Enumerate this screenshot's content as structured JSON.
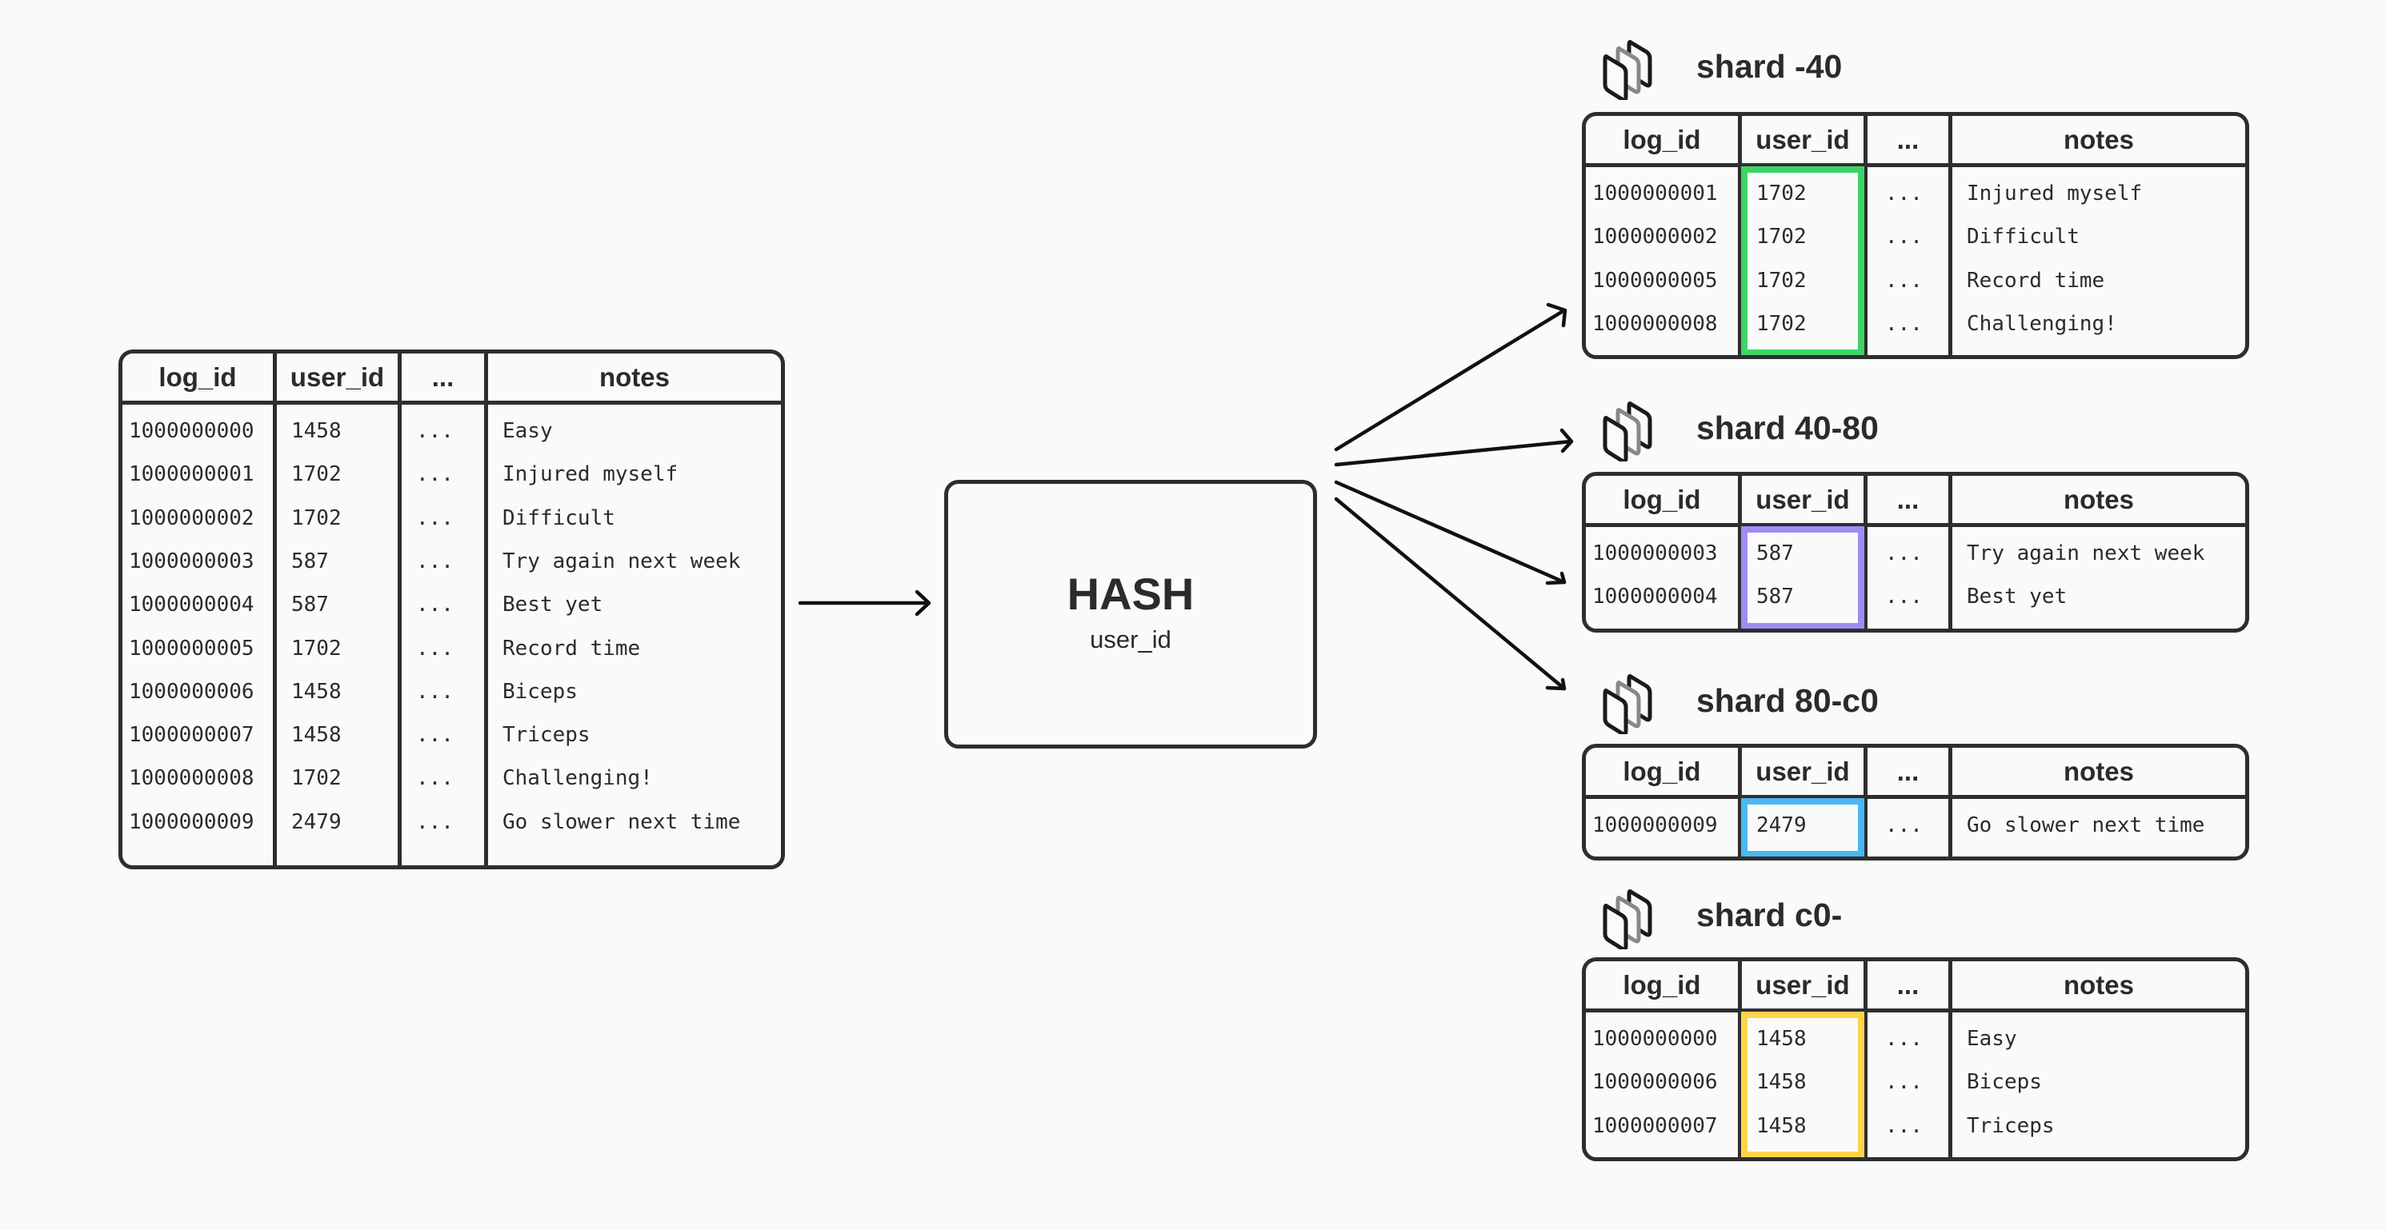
{
  "columns": [
    "log_id",
    "user_id",
    "...",
    "notes"
  ],
  "source_table": {
    "rows": [
      {
        "log_id": "1000000000",
        "user_id": "1458",
        "etc": "...",
        "notes": "Easy"
      },
      {
        "log_id": "1000000001",
        "user_id": "1702",
        "etc": "...",
        "notes": "Injured myself"
      },
      {
        "log_id": "1000000002",
        "user_id": "1702",
        "etc": "...",
        "notes": "Difficult"
      },
      {
        "log_id": "1000000003",
        "user_id": "587",
        "etc": "...",
        "notes": "Try again next week"
      },
      {
        "log_id": "1000000004",
        "user_id": "587",
        "etc": "...",
        "notes": "Best yet"
      },
      {
        "log_id": "1000000005",
        "user_id": "1702",
        "etc": "...",
        "notes": "Record time"
      },
      {
        "log_id": "1000000006",
        "user_id": "1458",
        "etc": "...",
        "notes": "Biceps"
      },
      {
        "log_id": "1000000007",
        "user_id": "1458",
        "etc": "...",
        "notes": "Triceps"
      },
      {
        "log_id": "1000000008",
        "user_id": "1702",
        "etc": "...",
        "notes": "Challenging!"
      },
      {
        "log_id": "1000000009",
        "user_id": "2479",
        "etc": "...",
        "notes": "Go slower next time"
      }
    ]
  },
  "hash": {
    "title": "HASH",
    "key": "user_id"
  },
  "shards": [
    {
      "name": "shard -40",
      "icon": "shard-stack-icon",
      "highlight_color": "#3dd566",
      "rows": [
        {
          "log_id": "1000000001",
          "user_id": "1702",
          "etc": "...",
          "notes": "Injured myself"
        },
        {
          "log_id": "1000000002",
          "user_id": "1702",
          "etc": "...",
          "notes": "Difficult"
        },
        {
          "log_id": "1000000005",
          "user_id": "1702",
          "etc": "...",
          "notes": "Record time"
        },
        {
          "log_id": "1000000008",
          "user_id": "1702",
          "etc": "...",
          "notes": "Challenging!"
        }
      ]
    },
    {
      "name": "shard 40-80",
      "icon": "shard-stack-icon",
      "highlight_color": "#a18bf2",
      "rows": [
        {
          "log_id": "1000000003",
          "user_id": "587",
          "etc": "...",
          "notes": "Try again next week"
        },
        {
          "log_id": "1000000004",
          "user_id": "587",
          "etc": "...",
          "notes": "Best yet"
        }
      ]
    },
    {
      "name": "shard 80-c0",
      "icon": "shard-stack-icon",
      "highlight_color": "#4ab7f3",
      "rows": [
        {
          "log_id": "1000000009",
          "user_id": "2479",
          "etc": "...",
          "notes": "Go slower next time"
        }
      ]
    },
    {
      "name": "shard c0-",
      "icon": "shard-stack-icon",
      "highlight_color": "#fdd44b",
      "rows": [
        {
          "log_id": "1000000000",
          "user_id": "1458",
          "etc": "...",
          "notes": "Easy"
        },
        {
          "log_id": "1000000006",
          "user_id": "1458",
          "etc": "...",
          "notes": "Biceps"
        },
        {
          "log_id": "1000000007",
          "user_id": "1458",
          "etc": "...",
          "notes": "Triceps"
        }
      ]
    }
  ]
}
